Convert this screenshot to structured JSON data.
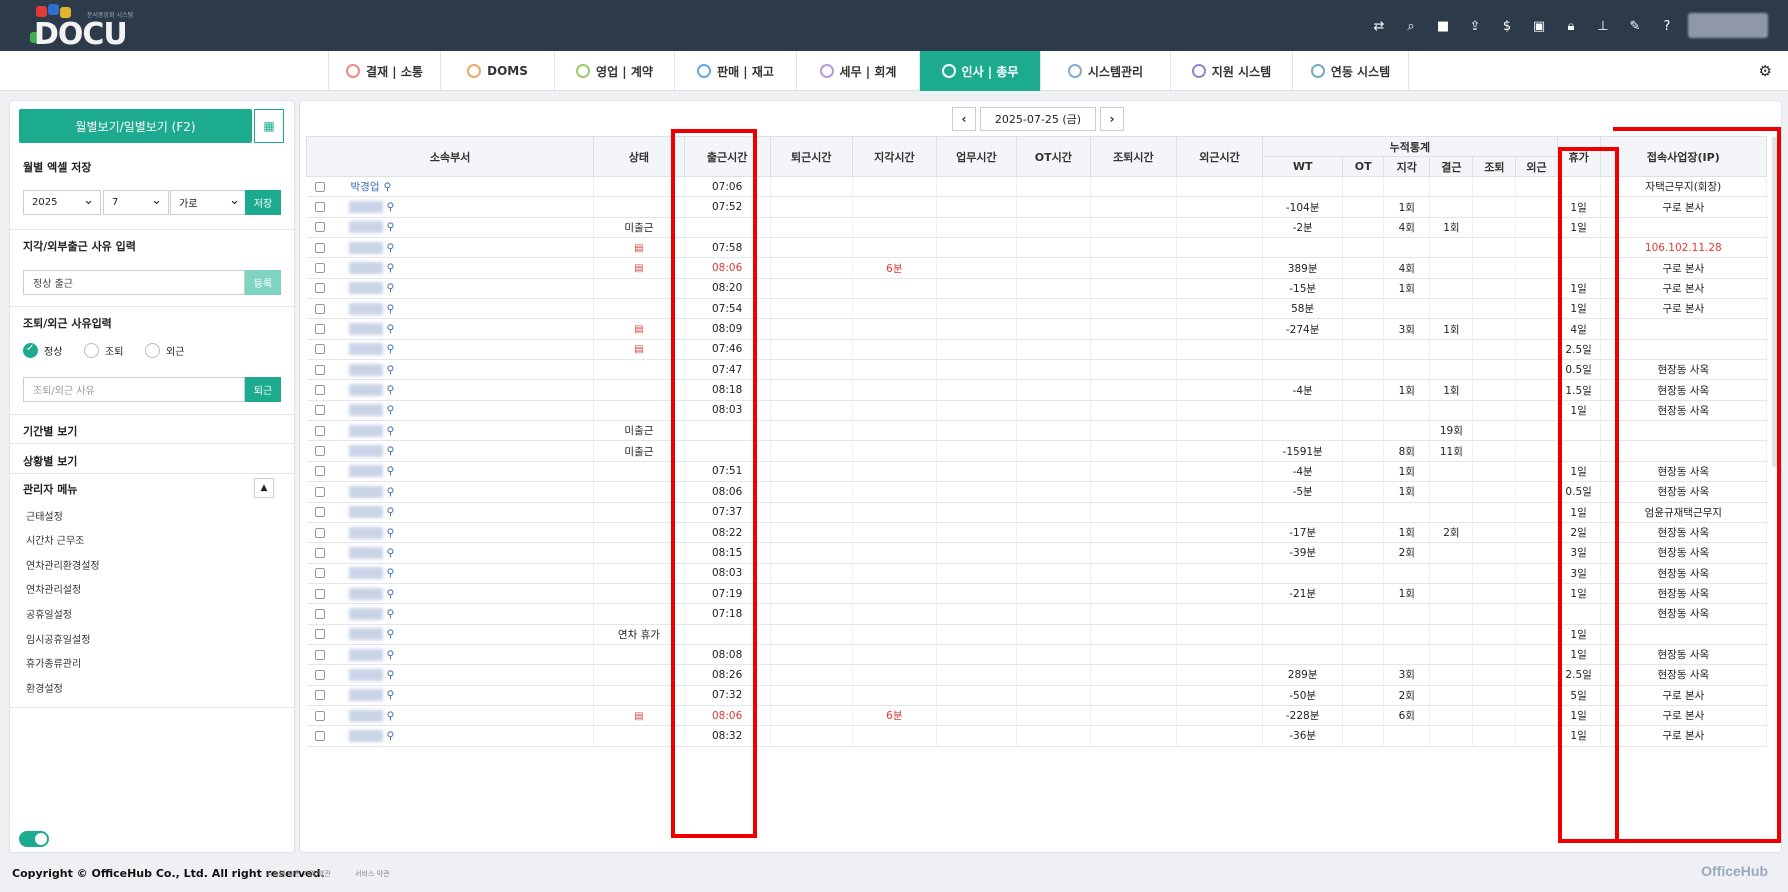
{
  "header": {
    "logo_text": "DOCU",
    "logo_sub": "문서중앙화 시스템",
    "icons": [
      "swap-icon",
      "search-icon",
      "video-icon",
      "share-icon",
      "dollar-icon",
      "briefcase-icon",
      "lock-icon",
      "org-chart-icon",
      "edit-icon",
      "help-icon"
    ]
  },
  "nav": {
    "tabs": [
      {
        "label": "결재 | 소통",
        "icon": "approval-icon"
      },
      {
        "label": "DOMS",
        "icon": "doms-icon"
      },
      {
        "label": "영업 | 계약",
        "icon": "sales-icon"
      },
      {
        "label": "판매 | 재고",
        "icon": "cart-icon"
      },
      {
        "label": "세무 | 회계",
        "icon": "won-icon"
      },
      {
        "label": "인사 | 총무",
        "icon": "hr-icon"
      },
      {
        "label": "시스템관리",
        "icon": "system-icon"
      },
      {
        "label": "지원 시스템",
        "icon": "support-icon"
      },
      {
        "label": "연동 시스템",
        "icon": "link-icon"
      }
    ],
    "active": "인사 | 총무"
  },
  "sidebar": {
    "view_button": "월별보기/일별보기 (F2)",
    "excel_title": "월별 엑셀 저장",
    "year": "2025",
    "month": "7",
    "orient": "가로",
    "save": "저장",
    "reason_title": "지각/외부출근 사유 입력",
    "reason_value": "정상 출근",
    "register": "등록",
    "leave_title": "조퇴/외근 사유입력",
    "radios": [
      "정상",
      "조퇴",
      "외근"
    ],
    "leave_placeholder": "조퇴/외근 사유",
    "leave_btn": "퇴근",
    "period": "기간별 보기",
    "status_view": "상황별 보기",
    "admin": "관리자 메뉴",
    "admin_items": [
      "근태설정",
      "시간차 근무조",
      "연차관리환경설정",
      "연차관리설정",
      "공휴일설정",
      "임시공휴일설정",
      "휴가종류관리",
      "환경설정"
    ]
  },
  "main": {
    "date": "2025-07-25 (금)",
    "headers": {
      "dept": "소속부서",
      "status": "상태",
      "in": "출근시간",
      "out": "퇴근시간",
      "late": "지각시간",
      "work": "업무시간",
      "ot": "OT시간",
      "early": "조퇴시간",
      "outside": "외근시간",
      "cum": "누적통계",
      "wt": "WT",
      "cot": "OT",
      "clate": "지각",
      "cabs": "결근",
      "cearly": "조퇴",
      "cout": "외근",
      "leave": "휴가",
      "ip": "접속사업장(IP)"
    },
    "rows": [
      {
        "name": "박경업",
        "status": "",
        "doc": false,
        "in": "07:06",
        "late": "",
        "wt": "",
        "cl": "",
        "ca": "",
        "lv": "",
        "ip": "자택근무지(회장)",
        "red": false,
        "ipred": false
      },
      {
        "name": "",
        "status": "",
        "doc": false,
        "in": "07:52",
        "late": "",
        "wt": "-104분",
        "cl": "1회",
        "ca": "",
        "lv": "1일",
        "ip": "구로 본사",
        "red": false,
        "ipred": false
      },
      {
        "name": "",
        "status": "미출근",
        "doc": false,
        "in": "",
        "late": "",
        "wt": "-2분",
        "cl": "4회",
        "ca": "1회",
        "lv": "1일",
        "ip": "",
        "red": false,
        "ipred": false
      },
      {
        "name": "",
        "status": "",
        "doc": true,
        "in": "07:58",
        "late": "",
        "wt": "",
        "cl": "",
        "ca": "",
        "lv": "",
        "ip": "106.102.11.28",
        "red": false,
        "ipred": true
      },
      {
        "name": "",
        "status": "",
        "doc": true,
        "in": "08:06",
        "late": "6분",
        "wt": "389분",
        "cl": "4회",
        "ca": "",
        "lv": "",
        "ip": "구로 본사",
        "red": true,
        "ipred": false
      },
      {
        "name": "",
        "status": "",
        "doc": false,
        "in": "08:20",
        "late": "",
        "wt": "-15분",
        "cl": "1회",
        "ca": "",
        "lv": "1일",
        "ip": "구로 본사",
        "red": false,
        "ipred": false
      },
      {
        "name": "",
        "status": "",
        "doc": false,
        "in": "07:54",
        "late": "",
        "wt": "58분",
        "cl": "",
        "ca": "",
        "lv": "1일",
        "ip": "구로 본사",
        "red": false,
        "ipred": false
      },
      {
        "name": "",
        "status": "",
        "doc": true,
        "in": "08:09",
        "late": "",
        "wt": "-274분",
        "cl": "3회",
        "ca": "1회",
        "lv": "4일",
        "ip": "",
        "red": false,
        "ipred": false
      },
      {
        "name": "",
        "status": "",
        "doc": true,
        "in": "07:46",
        "late": "",
        "wt": "",
        "cl": "",
        "ca": "",
        "lv": "2.5일",
        "ip": "",
        "red": false,
        "ipred": false
      },
      {
        "name": "",
        "status": "",
        "doc": false,
        "in": "07:47",
        "late": "",
        "wt": "",
        "cl": "",
        "ca": "",
        "lv": "0.5일",
        "ip": "현장동 사옥",
        "red": false,
        "ipred": false
      },
      {
        "name": "",
        "status": "",
        "doc": false,
        "in": "08:18",
        "late": "",
        "wt": "-4분",
        "cl": "1회",
        "ca": "1회",
        "lv": "1.5일",
        "ip": "현장동 사옥",
        "red": false,
        "ipred": false
      },
      {
        "name": "",
        "status": "",
        "doc": false,
        "in": "08:03",
        "late": "",
        "wt": "",
        "cl": "",
        "ca": "",
        "lv": "1일",
        "ip": "현장동 사옥",
        "red": false,
        "ipred": false
      },
      {
        "name": "",
        "status": "미출근",
        "doc": false,
        "in": "",
        "late": "",
        "wt": "",
        "cl": "",
        "ca": "19회",
        "lv": "",
        "ip": "",
        "red": false,
        "ipred": false
      },
      {
        "name": "",
        "status": "미출근",
        "doc": false,
        "in": "",
        "late": "",
        "wt": "-1591분",
        "cl": "8회",
        "ca": "11회",
        "lv": "",
        "ip": "",
        "red": false,
        "ipred": false
      },
      {
        "name": "",
        "status": "",
        "doc": false,
        "in": "07:51",
        "late": "",
        "wt": "-4분",
        "cl": "1회",
        "ca": "",
        "lv": "1일",
        "ip": "현장동 사옥",
        "red": false,
        "ipred": false
      },
      {
        "name": "",
        "status": "",
        "doc": false,
        "in": "08:06",
        "late": "",
        "wt": "-5분",
        "cl": "1회",
        "ca": "",
        "lv": "0.5일",
        "ip": "현장동 사옥",
        "red": false,
        "ipred": false
      },
      {
        "name": "",
        "status": "",
        "doc": false,
        "in": "07:37",
        "late": "",
        "wt": "",
        "cl": "",
        "ca": "",
        "lv": "1일",
        "ip": "엄윤규재택근무지",
        "red": false,
        "ipred": false
      },
      {
        "name": "",
        "status": "",
        "doc": false,
        "in": "08:22",
        "late": "",
        "wt": "-17분",
        "cl": "1회",
        "ca": "2회",
        "lv": "2일",
        "ip": "현장동 사옥",
        "red": false,
        "ipred": false
      },
      {
        "name": "",
        "status": "",
        "doc": false,
        "in": "08:15",
        "late": "",
        "wt": "-39분",
        "cl": "2회",
        "ca": "",
        "lv": "3일",
        "ip": "현장동 사옥",
        "red": false,
        "ipred": false
      },
      {
        "name": "",
        "status": "",
        "doc": false,
        "in": "08:03",
        "late": "",
        "wt": "",
        "cl": "",
        "ca": "",
        "lv": "3일",
        "ip": "현장동 사옥",
        "red": false,
        "ipred": false
      },
      {
        "name": "",
        "status": "",
        "doc": false,
        "in": "07:19",
        "late": "",
        "wt": "-21분",
        "cl": "1회",
        "ca": "",
        "lv": "1일",
        "ip": "현장동 사옥",
        "red": false,
        "ipred": false
      },
      {
        "name": "",
        "status": "",
        "doc": false,
        "in": "07:18",
        "late": "",
        "wt": "",
        "cl": "",
        "ca": "",
        "lv": "",
        "ip": "현장동 사옥",
        "red": false,
        "ipred": false
      },
      {
        "name": "",
        "status": "연차 휴가",
        "doc": false,
        "in": "",
        "late": "",
        "wt": "",
        "cl": "",
        "ca": "",
        "lv": "1일",
        "ip": "",
        "red": false,
        "ipred": false
      },
      {
        "name": "",
        "status": "",
        "doc": false,
        "in": "08:08",
        "late": "",
        "wt": "",
        "cl": "",
        "ca": "",
        "lv": "1일",
        "ip": "현장동 사옥",
        "red": false,
        "ipred": false
      },
      {
        "name": "",
        "status": "",
        "doc": false,
        "in": "08:26",
        "late": "",
        "wt": "289분",
        "cl": "3회",
        "ca": "",
        "lv": "2.5일",
        "ip": "현장동 사옥",
        "red": false,
        "ipred": false
      },
      {
        "name": "",
        "status": "",
        "doc": false,
        "in": "07:32",
        "late": "",
        "wt": "-50분",
        "cl": "2회",
        "ca": "",
        "lv": "5일",
        "ip": "구로 본사",
        "red": false,
        "ipred": false
      },
      {
        "name": "",
        "status": "",
        "doc": true,
        "in": "08:06",
        "late": "6분",
        "wt": "-228분",
        "cl": "6회",
        "ca": "",
        "lv": "1일",
        "ip": "구로 본사",
        "red": true,
        "ipred": false
      },
      {
        "name": "",
        "status": "",
        "doc": false,
        "in": "08:32",
        "late": "",
        "wt": "-36분",
        "cl": "",
        "ca": "",
        "lv": "1일",
        "ip": "구로 본사",
        "red": false,
        "ipred": false
      }
    ]
  },
  "footer": {
    "copyright": "Copyright © OfficeHub Co., Ltd. All right reserved.",
    "link1": "시스템 표준 가격 약관",
    "link2": "서비스 약관",
    "brand": "OfficeHub"
  },
  "colors": {
    "accent": "#1dab8f",
    "topbar": "#2d3a4a",
    "highlight": "#ee0000",
    "late": "#e53935"
  }
}
